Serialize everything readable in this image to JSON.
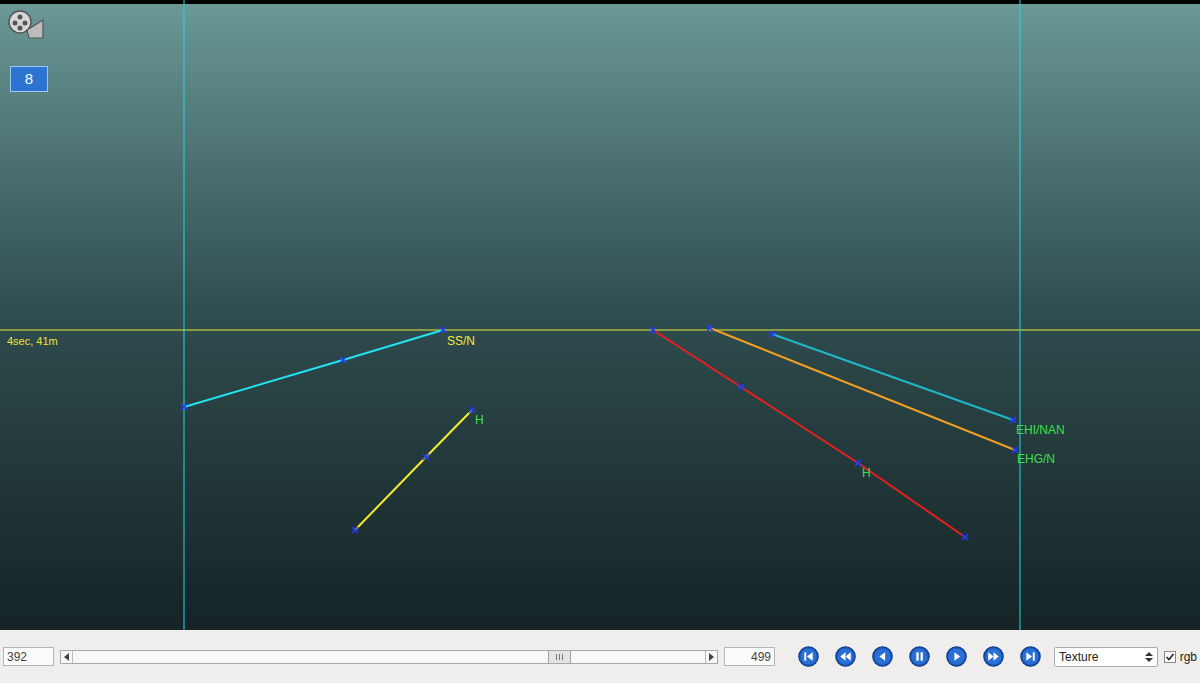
{
  "viewer": {
    "overlay_text": "4sec, 41m",
    "reel_badge": "8",
    "lanes": [
      {
        "label": "SS/N",
        "color": "#22e3f2",
        "label_color": "#f2ea3a"
      },
      {
        "label": "H",
        "color": "#f5ee2a",
        "label_color": "#3de04a"
      },
      {
        "label": "H",
        "color": "#e8201c",
        "label_color": "#3de04a"
      },
      {
        "label": "EHG/N",
        "color": "#f0a020",
        "label_color": "#3de04a"
      },
      {
        "label": "EHI/NAN",
        "color": "#1fb8c8",
        "label_color": "#3de04a"
      }
    ]
  },
  "toolbar": {
    "current_frame": "392",
    "last_frame": "499",
    "timeline": {
      "level": 0.77
    },
    "controls": [
      {
        "kind": "first"
      },
      {
        "kind": "rewind"
      },
      {
        "kind": "back"
      },
      {
        "kind": "pause"
      },
      {
        "kind": "play"
      },
      {
        "kind": "forward"
      },
      {
        "kind": "last"
      }
    ],
    "mode": {
      "value": "Texture"
    },
    "rgb": {
      "label": "rgb",
      "checked": true
    }
  }
}
